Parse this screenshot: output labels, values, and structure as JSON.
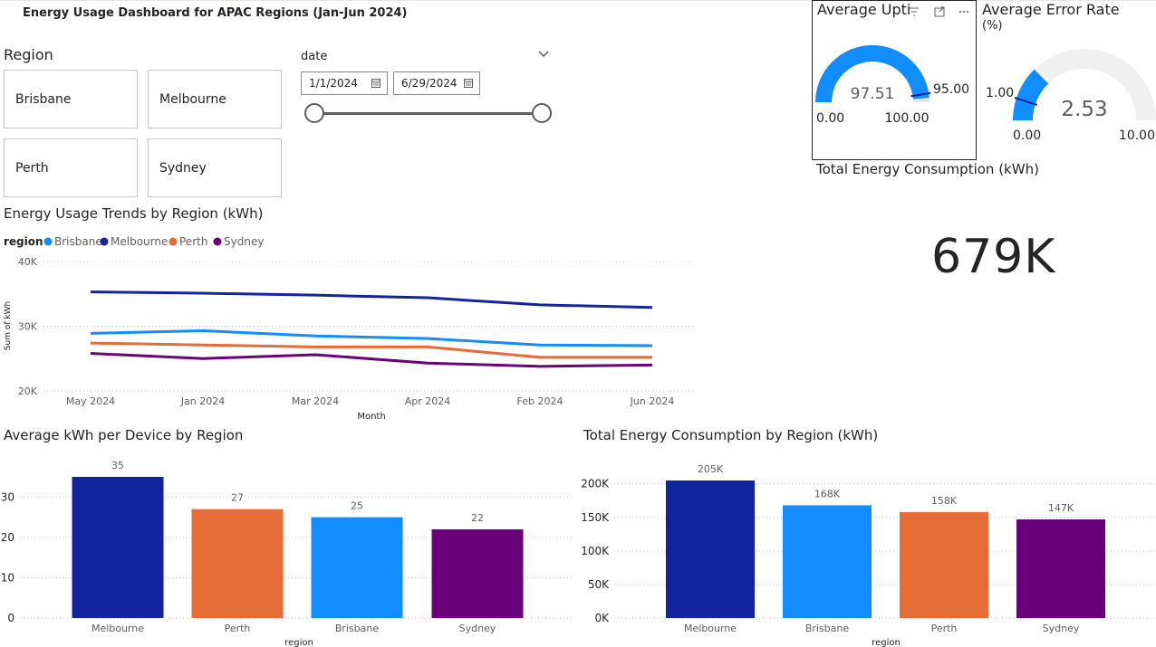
{
  "dashboard": {
    "title": "Energy Usage Dashboard for APAC Regions (Jan-Jun 2024)"
  },
  "region_slicer": {
    "title": "Region",
    "options": [
      "Brisbane",
      "Melbourne",
      "Perth",
      "Sydney"
    ]
  },
  "date_slicer": {
    "title": "date",
    "start": "1/1/2024",
    "end": "6/29/2024",
    "icons": {
      "calendar": "calendar-icon",
      "collapse": "chevron-down-icon"
    }
  },
  "uptime_gauge": {
    "title": "Average Upti",
    "value": 97.51,
    "value_label": "97.51",
    "min_label": "0.00",
    "max_label": "100.00",
    "target": 95.0,
    "target_label": "95.00",
    "min": 0,
    "max": 100,
    "fill_color": "#118DFF",
    "track_color": "#E6E6E6",
    "target_color": "#12239E",
    "header_icons": [
      "filter-icon",
      "focus-mode-icon",
      "more-options-icon"
    ]
  },
  "error_gauge": {
    "title_line1": "Average Error Rate",
    "title_line2": "(%)",
    "value": 2.53,
    "value_label": "2.53",
    "min_label": "0.00",
    "max_label": "10.00",
    "target": 1.0,
    "target_label": "1.00",
    "min": 0,
    "max": 10,
    "fill_color": "#118DFF",
    "track_color": "#F0F0F0",
    "target_color": "#12239E"
  },
  "total_card": {
    "title": "Total Energy Consumption (kWh)",
    "value": "679K"
  },
  "colors": {
    "Brisbane": "#118DFF",
    "Melbourne": "#12239E",
    "Perth": "#E66C37",
    "Sydney": "#6B007B",
    "grid": "#C8C6C4",
    "axis_text": "#605E5C"
  },
  "chart_data": [
    {
      "type": "line",
      "title": "Energy Usage Trends by Region (kWh)",
      "legend_title": "region",
      "legend_position": "top-left",
      "xlabel": "Month",
      "ylabel": "Sum of kWh",
      "categories": [
        "May 2024",
        "Jan 2024",
        "Mar 2024",
        "Apr 2024",
        "Feb 2024",
        "Jun 2024"
      ],
      "ylim": [
        20000,
        40000
      ],
      "yticks": [
        20000,
        30000,
        40000
      ],
      "ytick_labels": [
        "20K",
        "30K",
        "40K"
      ],
      "grid": true,
      "series": [
        {
          "name": "Brisbane",
          "values": [
            28900,
            29300,
            28500,
            28100,
            27100,
            27000
          ]
        },
        {
          "name": "Melbourne",
          "values": [
            35300,
            35100,
            34800,
            34400,
            33300,
            32900
          ]
        },
        {
          "name": "Perth",
          "values": [
            27400,
            27100,
            26800,
            26800,
            25200,
            25200
          ]
        },
        {
          "name": "Sydney",
          "values": [
            25800,
            25000,
            25600,
            24300,
            23800,
            24000
          ]
        }
      ]
    },
    {
      "type": "bar",
      "title": "Average kWh per Device by Region",
      "xlabel": "region",
      "ylabel": "",
      "categories": [
        "Melbourne",
        "Perth",
        "Brisbane",
        "Sydney"
      ],
      "values": [
        35,
        27,
        25,
        22
      ],
      "value_labels": [
        "35",
        "27",
        "25",
        "22"
      ],
      "ylim": [
        0,
        35
      ],
      "yticks": [
        0,
        10,
        20,
        30
      ],
      "ytick_labels": [
        "0",
        "10",
        "20",
        "30"
      ],
      "grid": true
    },
    {
      "type": "bar",
      "title": "Total Energy Consumption by Region (kWh)",
      "xlabel": "region",
      "ylabel": "",
      "categories": [
        "Melbourne",
        "Brisbane",
        "Perth",
        "Sydney"
      ],
      "values": [
        205000,
        168000,
        158000,
        147000
      ],
      "value_labels": [
        "205K",
        "168K",
        "158K",
        "147K"
      ],
      "ylim": [
        0,
        205000
      ],
      "yticks": [
        0,
        50000,
        100000,
        150000,
        200000
      ],
      "ytick_labels": [
        "0K",
        "50K",
        "100K",
        "150K",
        "200K"
      ],
      "grid": true
    }
  ]
}
